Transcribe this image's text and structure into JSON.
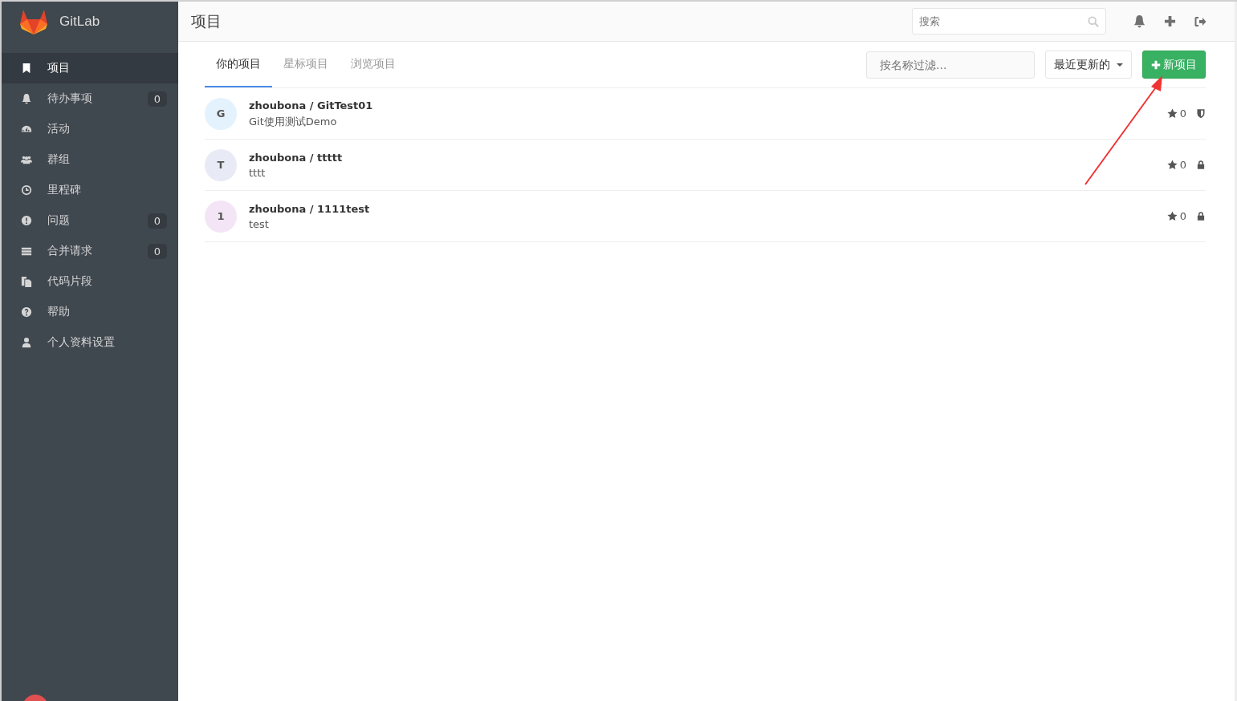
{
  "sidebar": {
    "brand": "GitLab",
    "items": [
      {
        "label": "项目",
        "selected": true
      },
      {
        "label": "待办事项",
        "selected": false,
        "count": "0"
      },
      {
        "label": "活动",
        "selected": false
      },
      {
        "label": "群组",
        "selected": false
      },
      {
        "label": "里程碑",
        "selected": false
      },
      {
        "label": "问题",
        "selected": false,
        "count": "0"
      },
      {
        "label": "合并请求",
        "selected": false,
        "count": "0"
      },
      {
        "label": "代码片段",
        "selected": false
      },
      {
        "label": "帮助",
        "selected": false
      },
      {
        "label": "个人资料设置",
        "selected": false
      }
    ]
  },
  "header": {
    "title": "项目",
    "search": {
      "placeholder": "搜索"
    }
  },
  "tabs": [
    {
      "label": "你的项目",
      "selected": true
    },
    {
      "label": "星标项目",
      "selected": false
    },
    {
      "label": "浏览项目",
      "selected": false
    }
  ],
  "filter": {
    "placeholder": "按名称过滤..."
  },
  "sort": {
    "label": "最近更新的"
  },
  "new_button": {
    "label": "新项目"
  },
  "projects": [
    {
      "letter": "G",
      "color": "#e3f2fd",
      "name": "zhoubona / GitTest01",
      "description": "Git使用测试Demo",
      "stars": "0",
      "kind": "shield"
    },
    {
      "letter": "T",
      "color": "#e8eaf6",
      "name": "zhoubona / ttttt",
      "description": "tttt",
      "stars": "0",
      "kind": "lock"
    },
    {
      "letter": "1",
      "color": "#f3e5f5",
      "name": "zhoubona / 1111test",
      "description": "test",
      "stars": "0",
      "kind": "lock"
    }
  ]
}
